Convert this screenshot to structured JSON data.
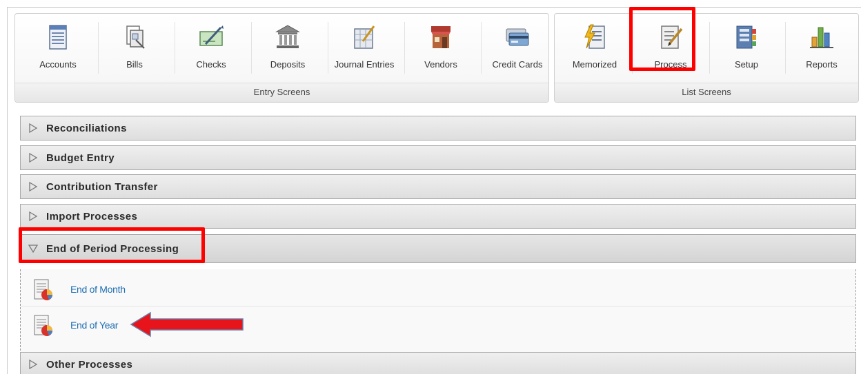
{
  "ribbon": {
    "entry_group": {
      "caption": "Entry Screens",
      "tools": [
        {
          "label": "Accounts",
          "icon": "accounts-icon"
        },
        {
          "label": "Bills",
          "icon": "bills-icon"
        },
        {
          "label": "Checks",
          "icon": "checks-icon"
        },
        {
          "label": "Deposits",
          "icon": "deposits-icon"
        },
        {
          "label": "Journal Entries",
          "icon": "journal-entries-icon"
        },
        {
          "label": "Vendors",
          "icon": "vendors-icon"
        },
        {
          "label": "Credit Cards",
          "icon": "credit-cards-icon"
        }
      ]
    },
    "list_group": {
      "caption": "List Screens",
      "tools": [
        {
          "label": "Memorized",
          "icon": "memorized-icon"
        },
        {
          "label": "Process",
          "icon": "process-icon"
        },
        {
          "label": "Setup",
          "icon": "setup-icon"
        },
        {
          "label": "Reports",
          "icon": "reports-icon"
        }
      ]
    }
  },
  "accordion": {
    "sections": [
      {
        "title": "Reconciliations",
        "expanded": false
      },
      {
        "title": "Budget Entry",
        "expanded": false
      },
      {
        "title": "Contribution Transfer",
        "expanded": false
      },
      {
        "title": "Import Processes",
        "expanded": false
      },
      {
        "title": "End of Period Processing",
        "expanded": true
      },
      {
        "title": "Other Processes",
        "expanded": false
      }
    ],
    "end_of_period_items": [
      {
        "label": "End of Month",
        "icon": "report-process-icon"
      },
      {
        "label": "End of Year",
        "icon": "report-process-icon"
      }
    ]
  },
  "colors": {
    "highlight": "#ff0000",
    "link": "#1f6fb2",
    "arrow": "#e8141b"
  }
}
